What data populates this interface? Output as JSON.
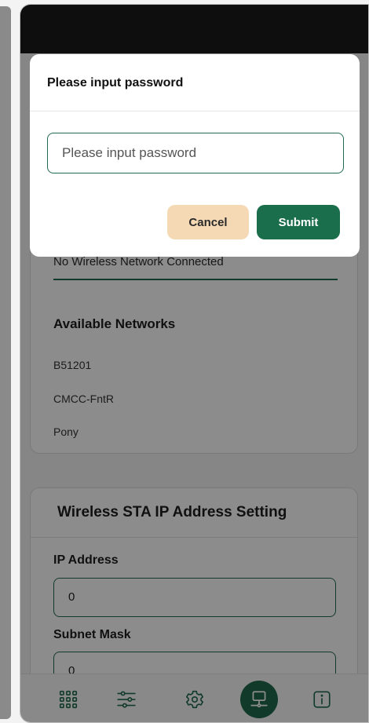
{
  "modal": {
    "title": "Please input password",
    "input_placeholder": "Please input password",
    "input_value": "",
    "cancel_label": "Cancel",
    "submit_label": "Submit"
  },
  "wireless_status": {
    "connected_text": "No Wireless Network Connected",
    "available_title": "Available Networks",
    "networks": [
      "B51201",
      "CMCC-FntR",
      "Pony"
    ]
  },
  "sta_ip_settings": {
    "title": "Wireless STA IP Address Setting",
    "ip_label": "IP Address",
    "ip_value": "0",
    "mask_label": "Subnet Mask",
    "mask_value": "0"
  },
  "bottom_nav": {
    "items": [
      {
        "icon": "grid-icon"
      },
      {
        "icon": "sliders-icon"
      },
      {
        "icon": "gear-icon"
      },
      {
        "icon": "network-icon",
        "active": true
      },
      {
        "icon": "info-icon"
      }
    ]
  },
  "colors": {
    "accent": "#1f6b4d",
    "cancel_bg": "#f5d9b4",
    "status_bar": "#1b1b1b"
  }
}
